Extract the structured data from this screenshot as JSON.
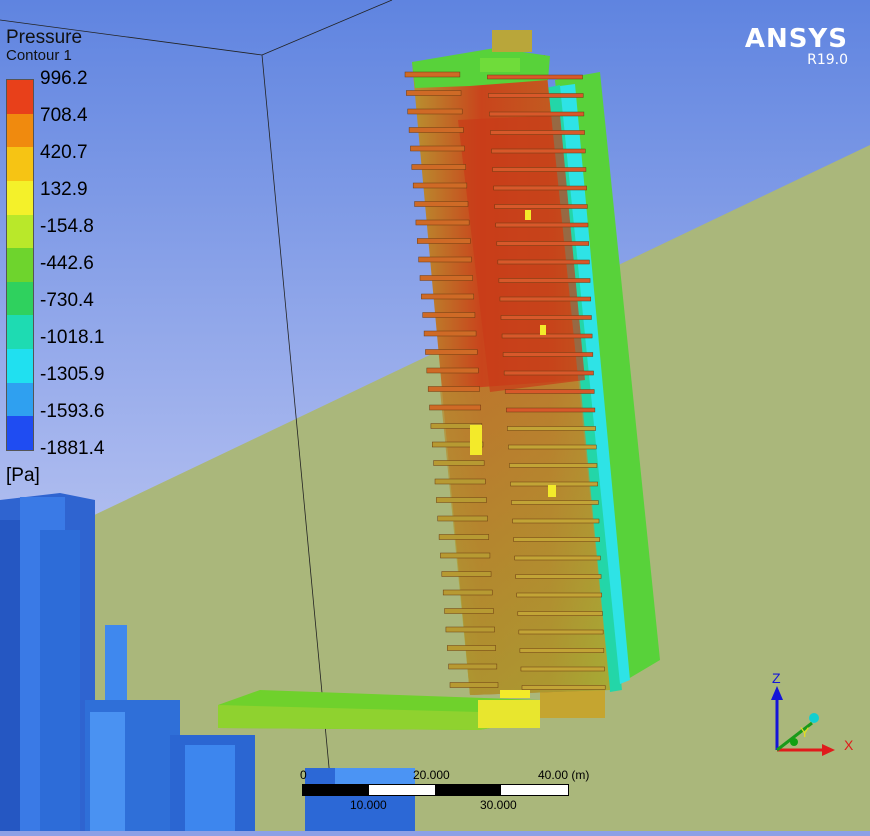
{
  "legend": {
    "title": "Pressure",
    "subtitle": "Contour 1",
    "values": [
      "996.2",
      "708.4",
      "420.7",
      "132.9",
      "-154.8",
      "-442.6",
      "-730.4",
      "-1018.1",
      "-1305.9",
      "-1593.6",
      "-1881.4"
    ],
    "colors": [
      "#e8401a",
      "#f08a0e",
      "#f6c414",
      "#f4f12a",
      "#b9e82a",
      "#6ed42d",
      "#2fd15e",
      "#1edbb2",
      "#20e0f0",
      "#2fa0f0",
      "#1f4cf2"
    ],
    "units": "[Pa]"
  },
  "brand": {
    "name": "ANSYS",
    "version": "R19.0"
  },
  "scale_bar": {
    "top_labels": [
      "0",
      "20.000",
      "40.00  (m)"
    ],
    "bottom_labels": [
      "10.000",
      "30.000"
    ]
  },
  "axes": {
    "z": "Z",
    "y": "Y",
    "x": "X"
  },
  "colors": {
    "sky": "#8da0e6",
    "ground": "#aab77b",
    "buildings": "#2f6fd8",
    "tower_high": "#c8401e",
    "tower_mid": "#a8a23a",
    "facade_green": "#58d23a"
  }
}
